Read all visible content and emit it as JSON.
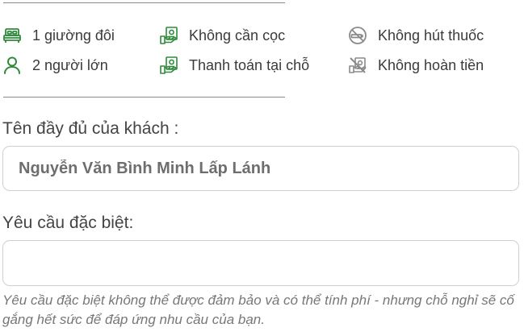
{
  "amenities": {
    "col1": [
      {
        "icon": "bed-icon",
        "label": "1 giường đôi"
      },
      {
        "icon": "person-icon",
        "label": "2 người lớn"
      }
    ],
    "col2": [
      {
        "icon": "money-icon",
        "label": "Không cần cọc"
      },
      {
        "icon": "money-icon",
        "label": "Thanh toán tại chỗ"
      }
    ],
    "col3": [
      {
        "icon": "no-smoking-icon",
        "label": "Không hút thuốc"
      },
      {
        "icon": "no-refund-icon",
        "label": "Không hoàn tiền"
      }
    ]
  },
  "guest_name": {
    "label": "Tên đầy đủ của khách :",
    "value": "Nguyễn Văn Bình Minh Lấp Lánh"
  },
  "special_request": {
    "label": "Yêu cầu đặc biệt:",
    "value": "",
    "note": "Yêu cầu đặc biệt không thể được đảm bảo và có thể tính phí - nhưng chỗ nghỉ sẽ cố gắng hết sức để đáp ứng nhu cầu của bạn."
  },
  "colors": {
    "accent": "#2e8b3a",
    "icon_gray": "#8a8a8a"
  }
}
